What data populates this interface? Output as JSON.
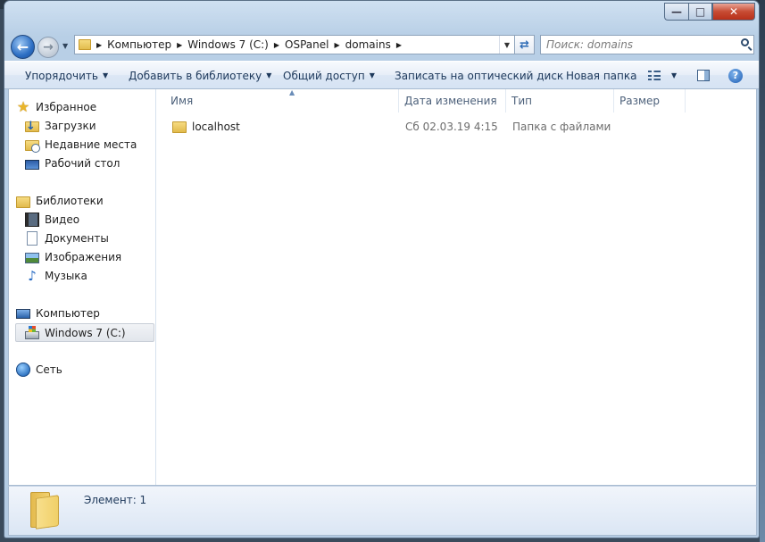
{
  "address_bar": {
    "crumbs": [
      "Компьютер",
      "Windows 7 (C:)",
      "OSPanel",
      "domains"
    ]
  },
  "search": {
    "placeholder": "Поиск: domains"
  },
  "toolbar": {
    "organize": "Упорядочить",
    "add_to_library": "Добавить в библиотеку",
    "share": "Общий доступ",
    "burn": "Записать на оптический диск",
    "new_folder": "Новая папка",
    "help": "?"
  },
  "nav_pane": {
    "favorites": "Избранное",
    "downloads": "Загрузки",
    "recent": "Недавние места",
    "desktop": "Рабочий стол",
    "libraries": "Библиотеки",
    "video": "Видео",
    "documents": "Документы",
    "pictures": "Изображения",
    "music": "Музыка",
    "computer": "Компьютер",
    "drive_c": "Windows 7 (C:)",
    "network": "Сеть"
  },
  "columns": {
    "name": "Имя",
    "date": "Дата изменения",
    "type": "Тип",
    "size": "Размер"
  },
  "files": [
    {
      "name": "localhost",
      "date": "Сб 02.03.19 4:15",
      "type": "Папка с файлами"
    }
  ],
  "status": {
    "text": "Элемент: 1"
  },
  "colors": {
    "accent": "#1e395b",
    "window_frame": "#b8cfe6",
    "close": "#c74b33"
  },
  "icons": [
    "back-arrow-icon",
    "forward-arrow-icon",
    "folder-icon",
    "refresh-icon",
    "search-icon",
    "views-icon",
    "preview-pane-icon",
    "help-icon",
    "star-icon",
    "downloads-icon",
    "recent-places-icon",
    "desktop-icon",
    "libraries-icon",
    "video-icon",
    "documents-icon",
    "pictures-icon",
    "music-icon",
    "computer-icon",
    "drive-icon",
    "network-icon"
  ]
}
